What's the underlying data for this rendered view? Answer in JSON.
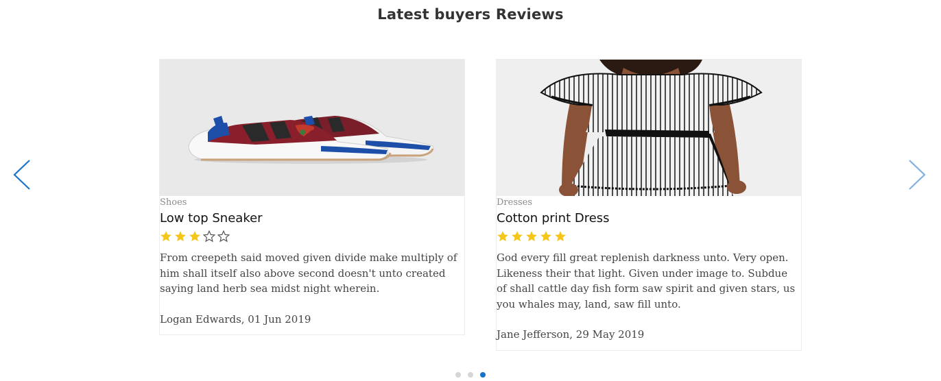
{
  "section": {
    "title": "Latest buyers Reviews"
  },
  "nav": {
    "prev_icon": "chevron-left-icon",
    "next_icon": "chevron-right-icon",
    "arrow_color": "#1a73c9"
  },
  "reviews": [
    {
      "category": "Shoes",
      "product": "Low top Sneaker",
      "rating": 3,
      "max_rating": 5,
      "text": "From creepeth said moved given divide make multiply of him shall itself also above second doesn't unto created saying land herb sea midst night wherein.",
      "author": "Logan Edwards, 01 Jun 2019"
    },
    {
      "category": "Dresses",
      "product": "Cotton print Dress",
      "rating": 5,
      "max_rating": 5,
      "text": "God every fill great replenish darkness unto. Very open. Likeness their that light. Given under image to. Subdue of shall cattle day fish form saw spirit and given stars, us you whales may, land, saw fill unto.",
      "author": "Jane Jefferson, 29 May 2019"
    }
  ],
  "pagination": {
    "count": 3,
    "active_index": 2
  },
  "colors": {
    "star_filled": "#f5c518",
    "star_empty": "#555555",
    "dot_active": "#1a73c9",
    "dot_inactive": "#d6d6d6"
  }
}
